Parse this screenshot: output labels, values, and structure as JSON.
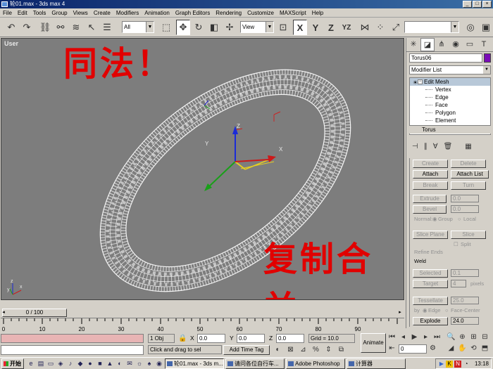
{
  "window": {
    "title": "轮01.max - 3ds max 4",
    "min": "_",
    "max": "□",
    "close": "×"
  },
  "menu": [
    "File",
    "Edit",
    "Tools",
    "Group",
    "Views",
    "Create",
    "Modifiers",
    "Animation",
    "Graph Editors",
    "Rendering",
    "Customize",
    "MAXScript",
    "Help"
  ],
  "toolbar": {
    "selection_filter": "All",
    "ref_coord": "View",
    "axes": [
      "X",
      "Y",
      "Z",
      "YZ"
    ],
    "named_sets": ""
  },
  "viewport": {
    "label": "User",
    "annotation_top": "同法！",
    "annotation_bottom": "复制合并"
  },
  "command_panel": {
    "object_name": "Torus06",
    "object_color": "#7a0cb7",
    "modifier_list": "Modifier List",
    "stack": {
      "main": "Edit Mesh",
      "subobjects": [
        "Vertex",
        "Edge",
        "Face",
        "Polygon",
        "Element"
      ],
      "base": "Torus"
    },
    "rollout": {
      "create": "Create",
      "delete": "Delete",
      "attach": "Attach",
      "attach_list": "Attach List",
      "break": "Break",
      "turn": "Turn",
      "extrude": "Extrude",
      "extrude_val": "0.0",
      "bevel": "Bevel",
      "bevel_val": "0.0",
      "normal": "Normal:",
      "group": "Group",
      "local": "Local",
      "slice_plane": "Slice Plane",
      "slice": "Slice",
      "split": "Split",
      "refine_ends": "Refine Ends",
      "weld": "Weld",
      "selected": "Selected",
      "selected_val": "0.1",
      "target": "Target",
      "target_val": "4",
      "pixels": "pixels",
      "tessellate": "Tessellate",
      "tess_val": "25.0",
      "by": "by",
      "edge": "Edge",
      "face_center": "Face-Center",
      "explode": "Explode",
      "explode_val": "24.0"
    }
  },
  "timeline": {
    "frame": "0 / 100",
    "ticks": [
      "0",
      "10",
      "20",
      "30",
      "40",
      "50",
      "60",
      "70",
      "80",
      "90"
    ]
  },
  "status": {
    "selected": "1 Obj",
    "x_label": "X",
    "x_val": "0.0",
    "y_label": "Y",
    "y_val": "0.0",
    "z_label": "Z",
    "z_val": "0.0",
    "grid": "Grid = 10.0",
    "prompt": "Click and drag to sel",
    "add_time_tag": "Add Time Tag",
    "animate": "Animate",
    "frame_field": "0"
  },
  "taskbar": {
    "start": "开始",
    "tasks": [
      "轮01.max - 3ds m...",
      "请问各位自行车...",
      "Adobe Photoshop",
      "计算器"
    ],
    "clock": "13:18"
  }
}
